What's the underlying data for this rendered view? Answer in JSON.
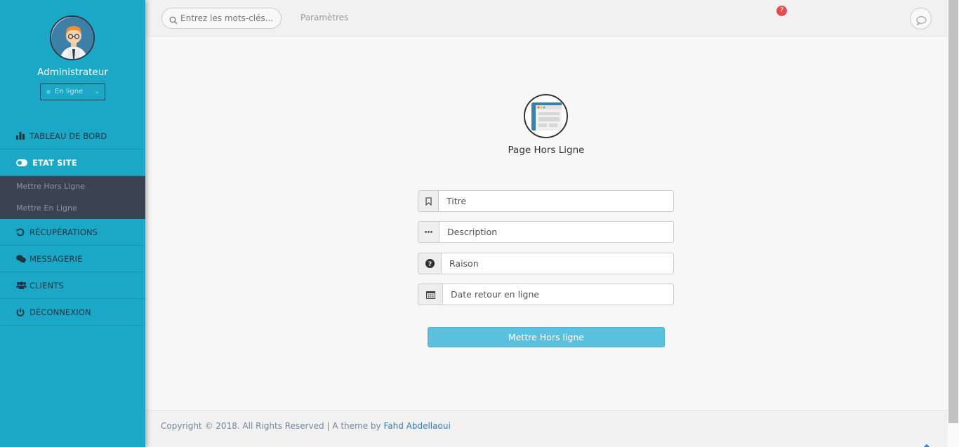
{
  "sidebar": {
    "username": "Administrateur",
    "status_select": "En ligne",
    "menu": {
      "dashboard": "TABLEAU DE BORD",
      "site_state": "ETAT SITE",
      "sub_offline": "Mettre Hors Ligne",
      "sub_online": "Mettre En Ligne",
      "recovery": "RÉCUPÉRATIONS",
      "messaging": "MESSAGERIE",
      "clients": "CLIENTS",
      "logout": "DÉCONNEXION"
    }
  },
  "topbar": {
    "search_placeholder": "Entrez les mots-clés...",
    "settings_link": "Paramètres",
    "notification_count": "7"
  },
  "main": {
    "page_title": "Page Hors Ligne",
    "fields": {
      "title_placeholder": "Titre",
      "description_placeholder": "Description",
      "reason_placeholder": "Raison",
      "date_placeholder": "Date retour en ligne"
    },
    "submit_label": "Mettre Hors ligne"
  },
  "footer": {
    "copyright": "Copyright © 2018. All Rights Reserved | A theme by ",
    "author": "Fahd Abdellaoui"
  },
  "colors": {
    "sidebar": "#1ba8c6",
    "submenu": "#3b4252",
    "button": "#5bc0de",
    "badge": "#e74c4c"
  }
}
